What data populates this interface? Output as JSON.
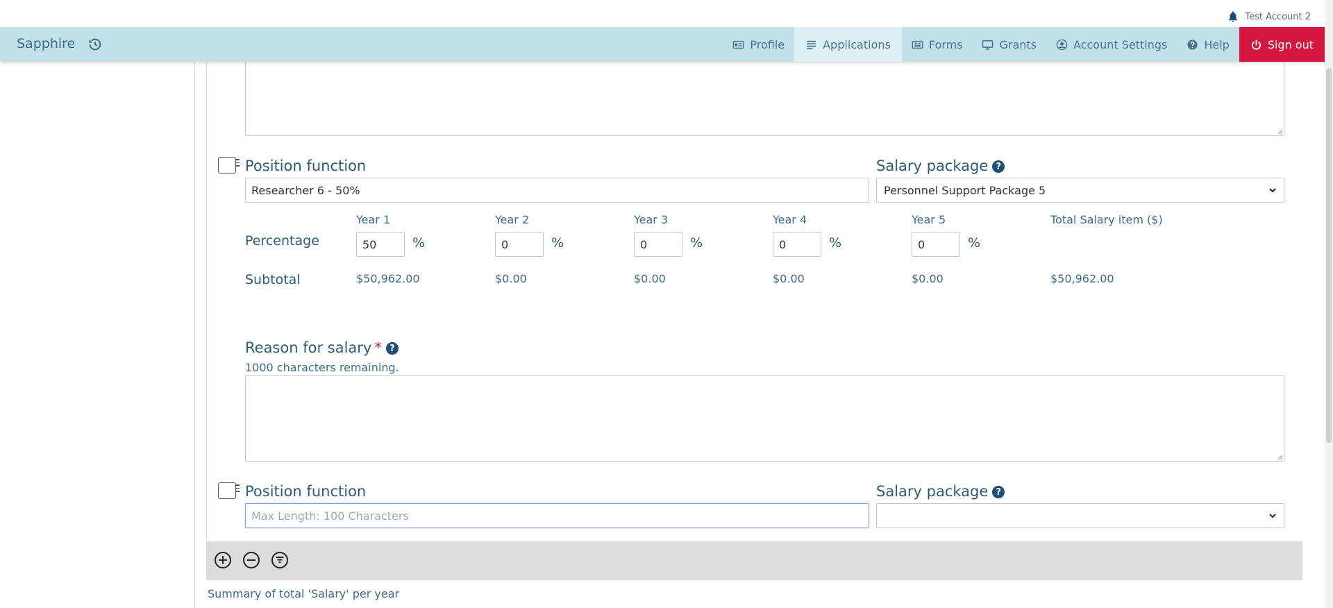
{
  "account": {
    "name": "Test Account 2"
  },
  "brand": {
    "name": "Sapphire"
  },
  "nav": {
    "profile": "Profile",
    "applications": "Applications",
    "forms": "Forms",
    "grants": "Grants",
    "account_settings": "Account Settings",
    "help": "Help",
    "sign_out": "Sign out"
  },
  "position1": {
    "position_label": "Position function",
    "position_value": "Researcher 6 - 50%",
    "salary_label": "Salary package",
    "salary_value": "Personnel Support Package 5",
    "percentage_label": "Percentage",
    "subtotal_label": "Subtotal",
    "years": [
      {
        "label": "Year 1",
        "percent": "50",
        "subtotal": "$50,962.00"
      },
      {
        "label": "Year 2",
        "percent": "0",
        "subtotal": "$0.00"
      },
      {
        "label": "Year 3",
        "percent": "0",
        "subtotal": "$0.00"
      },
      {
        "label": "Year 4",
        "percent": "0",
        "subtotal": "$0.00"
      },
      {
        "label": "Year 5",
        "percent": "0",
        "subtotal": "$0.00"
      }
    ],
    "percent_sign": "%",
    "total_label": "Total Salary item ($)",
    "total_value": "$50,962.00",
    "reason_label": "Reason for salary",
    "required_mark": "*",
    "remaining": "1000 characters remaining."
  },
  "position2": {
    "position_label": "Position function",
    "position_placeholder": "Max Length: 100 Characters",
    "salary_label": "Salary package",
    "salary_value": ""
  },
  "help_glyph": "?",
  "summary": "Summary of total 'Salary' per year",
  "colors": {
    "navbar": "#c2e0ea",
    "signout": "#d5173f",
    "accent": "#2f5a7a"
  }
}
